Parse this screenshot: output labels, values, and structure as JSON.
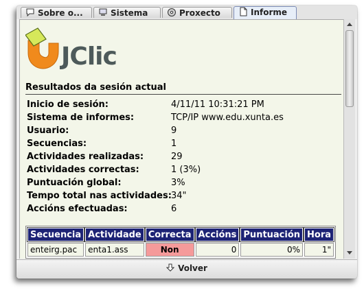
{
  "tabs": [
    {
      "label": "Sobre o...",
      "icon": "speech-bubble-icon"
    },
    {
      "label": "Sistema",
      "icon": "computer-icon"
    },
    {
      "label": "Proxecto",
      "icon": "disc-icon"
    },
    {
      "label": "Informe",
      "icon": "report-icon",
      "active": true
    }
  ],
  "logo": {
    "text": "JClic",
    "colors": {
      "orange": "#f08a1c",
      "yellow": "#d6e85a",
      "gray": "#4d5a5a"
    }
  },
  "report": {
    "title": "Resultados da sesión actual",
    "rows": [
      {
        "key": "Inicio de sesión:",
        "value": "4/11/11 10:31:21 PM"
      },
      {
        "key": "Sistema de informes:",
        "value": "TCP/IP www.edu.xunta.es"
      },
      {
        "key": "Usuario:",
        "value": "9"
      },
      {
        "key": "Secuencias:",
        "value": "1"
      },
      {
        "key": "Actividades realizadas:",
        "value": "29"
      },
      {
        "key": "Actividades correctas:",
        "value": "1 (3%)"
      },
      {
        "key": "Puntuación global:",
        "value": "3%"
      },
      {
        "key": "Tempo total nas actividades:",
        "value": "34\""
      },
      {
        "key": "Accións efectuadas:",
        "value": "6"
      }
    ]
  },
  "table": {
    "headers": [
      "Secuencia",
      "Actividade",
      "Correcta",
      "Accións",
      "Puntuación",
      "Hora"
    ],
    "rows": [
      [
        "enteirg.pac",
        "enta1.ass",
        "Non",
        "0",
        "0%",
        "1\""
      ]
    ]
  },
  "bottom": {
    "button_label": "Volver",
    "icon": "back-arrow-icon"
  },
  "colors": {
    "header_bg": "#1d2375",
    "panel_bg": "#f3f6e9",
    "incorrect_bg": "#f59a9a"
  }
}
